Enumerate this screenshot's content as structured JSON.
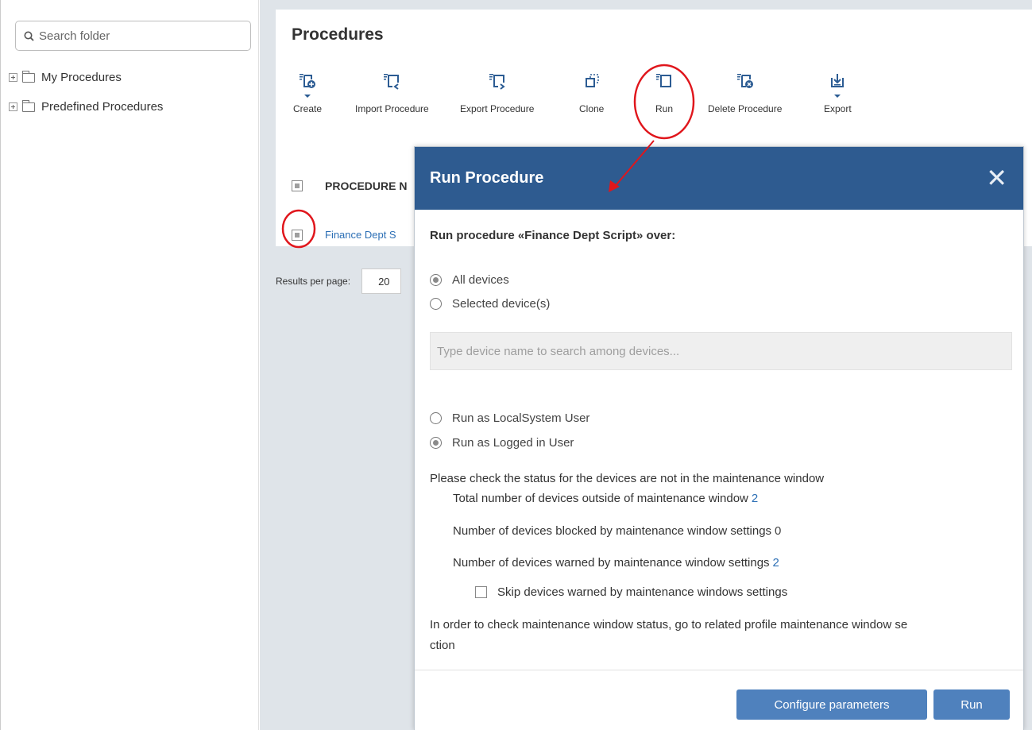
{
  "sidebar": {
    "search_placeholder": "Search folder",
    "tree": [
      {
        "label": "My Procedures"
      },
      {
        "label": "Predefined Procedures"
      }
    ]
  },
  "main": {
    "title": "Procedures",
    "toolbar": [
      {
        "label": "Create",
        "icon": "create-procedure-icon"
      },
      {
        "label": "Import Procedure",
        "icon": "import-procedure-icon"
      },
      {
        "label": "Export Procedure",
        "icon": "export-procedure-icon"
      },
      {
        "label": "Clone",
        "icon": "clone-icon"
      },
      {
        "label": "Run",
        "icon": "run-icon"
      },
      {
        "label": "Delete Procedure",
        "icon": "delete-procedure-icon"
      },
      {
        "label": "Export",
        "icon": "export-icon"
      }
    ],
    "table": {
      "column": "PROCEDURE N",
      "rows": [
        {
          "name": "Finance Dept S"
        }
      ]
    },
    "results_label": "Results per page:",
    "results_value": "20"
  },
  "modal": {
    "title": "Run Procedure",
    "close": "✕",
    "run_over": "Run procedure «Finance Dept Script» over:",
    "target_options": [
      {
        "label": "All devices",
        "selected": true
      },
      {
        "label": "Selected device(s)",
        "selected": false
      }
    ],
    "device_search_placeholder": "Type device name to search among devices...",
    "user_options": [
      {
        "label": "Run as LocalSystem User",
        "selected": false
      },
      {
        "label": "Run as Logged in User",
        "selected": true
      }
    ],
    "maintenance_intro": "Please check the status for the devices are not in the maintenance window",
    "stats": [
      {
        "label": "Total number of devices outside of maintenance window",
        "value": "2"
      },
      {
        "label": "Number of devices blocked by maintenance window settings",
        "value": "0"
      },
      {
        "label": "Number of devices warned by maintenance window settings",
        "value": "2"
      }
    ],
    "skip_label": "Skip devices warned by maintenance windows settings",
    "check_note_line1": "In order to check maintenance window status, go to related profile maintenance window se",
    "check_note_line2": "ction",
    "configure_button": "Configure parameters",
    "run_button": "Run"
  },
  "colors": {
    "modal_header": "#2e5b90",
    "button": "#4f81bd",
    "link": "#2c6fb5",
    "annotation": "#e0161c"
  }
}
